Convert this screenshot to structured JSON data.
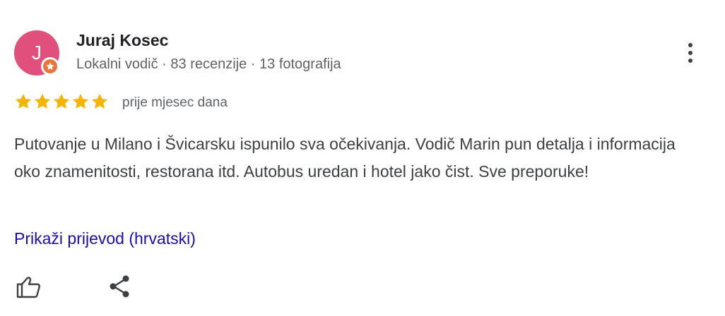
{
  "author": {
    "avatar_letter": "J",
    "avatar_color": "#e0507a",
    "badge_icon": "local-guide-star-icon",
    "badge_color": "#e8753a",
    "name": "Juraj Kosec",
    "meta": "Lokalni vodič · 83 recenzije · 13 fotografija"
  },
  "menu": {
    "icon": "more-vert-icon"
  },
  "rating": {
    "stars": 5,
    "max": 5,
    "star_color": "#f4b400",
    "time": "prije mjesec dana"
  },
  "review": {
    "text": "Putovanje u Milano i Švicarsku ispunilo sva očekivanja. Vodič Marin pun detalja i informacija oko znamenitosti, restorana itd. Autobus uredan i hotel jako čist. Sve preporuke!"
  },
  "translate": {
    "label": "Prikaži prijevod (hrvatski)",
    "link_color": "#1a0dab"
  },
  "actions": {
    "like_icon": "thumb-up-icon",
    "share_icon": "share-icon"
  }
}
